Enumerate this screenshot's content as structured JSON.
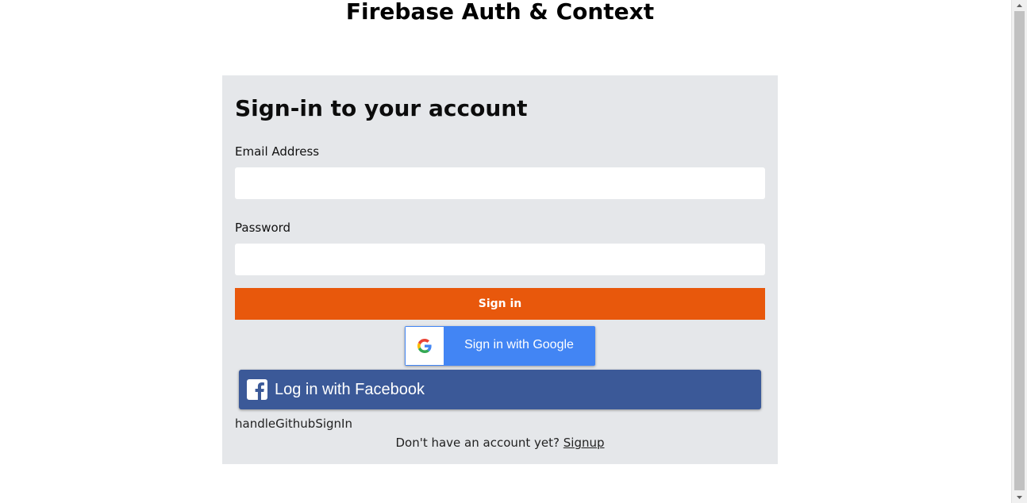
{
  "page": {
    "title": "Firebase Auth & Context"
  },
  "form": {
    "heading": "Sign-in to your account",
    "email_label": "Email Address",
    "email_value": "",
    "password_label": "Password",
    "password_value": "",
    "signin_label": "Sign in",
    "google_label": "Sign in with Google",
    "facebook_label": "Log in with Facebook",
    "github_text": "handleGithubSignIn",
    "signup_prompt": "Don't have an account yet?",
    "signup_link": "Signup"
  },
  "colors": {
    "card_background": "#e5e7ea",
    "signin_button": "#e8580c",
    "google_blue": "#4285f4",
    "facebook_blue": "#3b5998"
  },
  "icons": {
    "google": "google-g-icon",
    "facebook": "facebook-f-icon",
    "scroll_up": "arrow-up-icon",
    "scroll_down": "arrow-down-icon"
  }
}
